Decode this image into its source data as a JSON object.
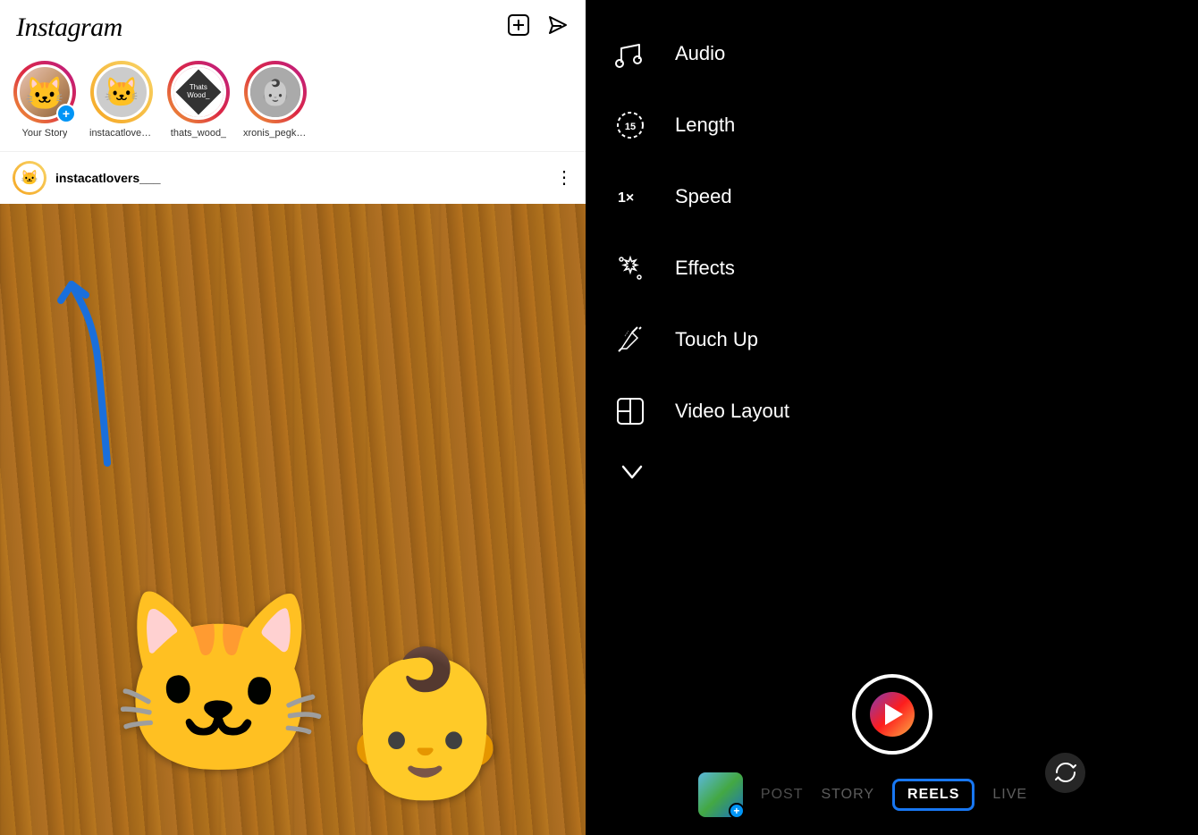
{
  "app": {
    "name": "Instagram"
  },
  "header": {
    "logo": "Instagram",
    "add_icon": "⊕",
    "dm_icon": "✈"
  },
  "stories": [
    {
      "id": "your-story",
      "label": "Your Story",
      "ring": "gradient",
      "avatar_type": "kitten"
    },
    {
      "id": "instacatlovers",
      "label": "instacatlovers...",
      "ring": "gold",
      "avatar_type": "cat"
    },
    {
      "id": "thats_wood",
      "label": "thats_wood_",
      "ring": "gradient",
      "avatar_type": "wood"
    },
    {
      "id": "xronis_pegk",
      "label": "xronis_pegk_...",
      "ring": "gradient",
      "avatar_type": "baby"
    }
  ],
  "post": {
    "username": "instacatlovers___",
    "avatar_type": "cat"
  },
  "right_panel": {
    "menu_items": [
      {
        "id": "audio",
        "label": "Audio",
        "icon": "music-note"
      },
      {
        "id": "length",
        "label": "Length",
        "icon": "timer",
        "badge": "15"
      },
      {
        "id": "speed",
        "label": "Speed",
        "icon": "speed",
        "badge": "1x"
      },
      {
        "id": "effects",
        "label": "Effects",
        "icon": "sparkles"
      },
      {
        "id": "touch-up",
        "label": "Touch Up",
        "icon": "wand"
      },
      {
        "id": "video-layout",
        "label": "Video Layout",
        "icon": "layout"
      }
    ],
    "chevron": "show-more",
    "mode_tabs": [
      {
        "id": "post",
        "label": "POST",
        "active": false
      },
      {
        "id": "story",
        "label": "STORY",
        "active": false
      },
      {
        "id": "reels",
        "label": "REELS",
        "active": true
      },
      {
        "id": "live",
        "label": "LIVE",
        "active": false
      }
    ]
  }
}
